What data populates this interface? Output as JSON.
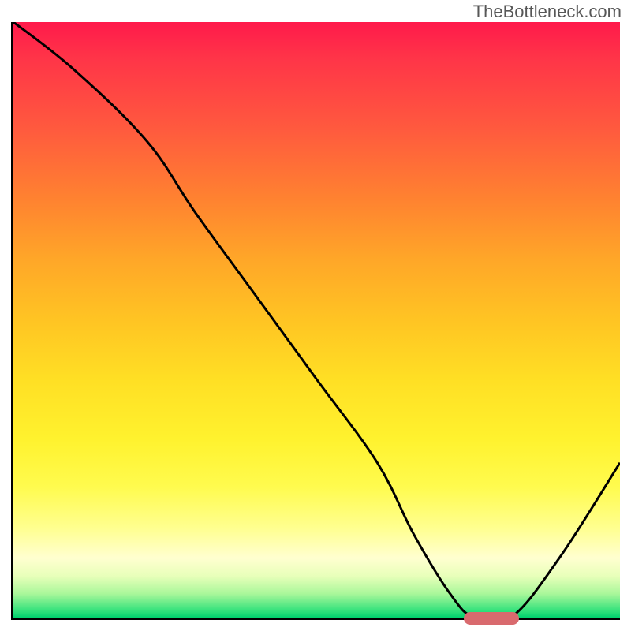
{
  "watermark": "TheBottleneck.com",
  "chart_data": {
    "type": "line",
    "title": "",
    "xlabel": "",
    "ylabel": "",
    "xlim": [
      0,
      100
    ],
    "ylim": [
      0,
      100
    ],
    "series": [
      {
        "name": "curve",
        "x": [
          0,
          10,
          22,
          30,
          40,
          50,
          60,
          66,
          72,
          76,
          82,
          90,
          100
        ],
        "values": [
          100,
          92,
          80,
          68,
          54,
          40,
          26,
          14,
          4,
          0,
          0,
          10,
          26
        ]
      }
    ],
    "marker": {
      "x_start": 74,
      "x_end": 83,
      "y": 0
    },
    "gradient_stops": [
      {
        "pct": 0,
        "color": "#ff1a4b"
      },
      {
        "pct": 50,
        "color": "#ffc423"
      },
      {
        "pct": 85,
        "color": "#ffff90"
      },
      {
        "pct": 100,
        "color": "#00d16e"
      }
    ]
  }
}
